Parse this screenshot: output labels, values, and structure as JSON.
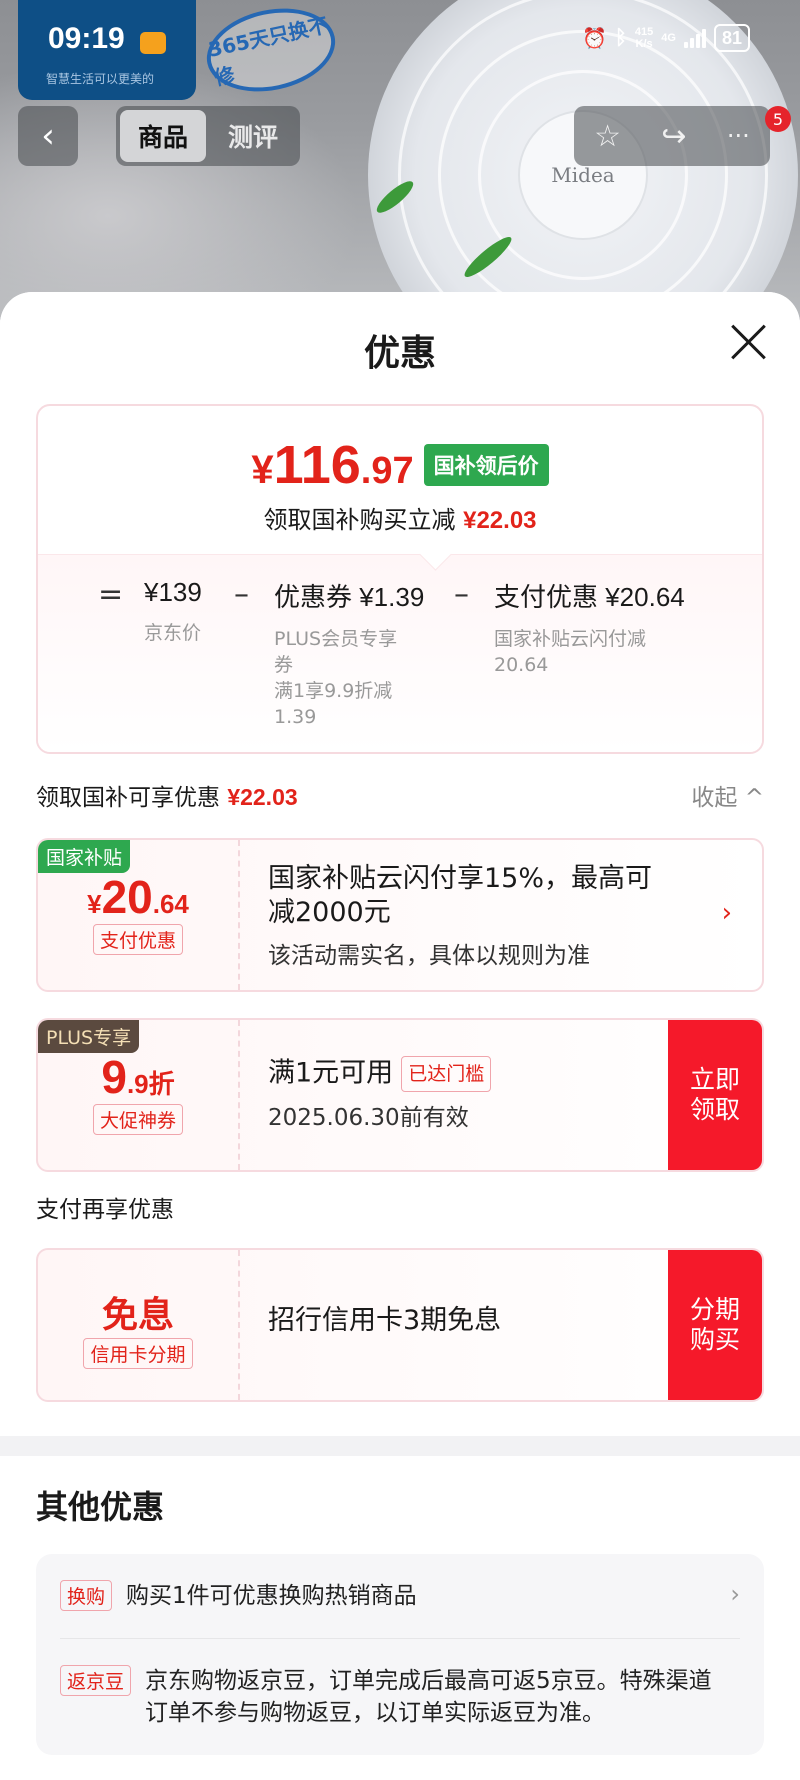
{
  "status_bar": {
    "time": "09:19",
    "slogan": "智慧生活可以更美的",
    "promo_stamp": "365天只换不修",
    "network_speed_top": "415",
    "network_speed_bottom": "K/s",
    "network_type": "4G",
    "battery": "81"
  },
  "nav": {
    "back_icon": "‹",
    "tabs": [
      "商品",
      "测评"
    ],
    "active_tab": "商品",
    "cart_badge": "5"
  },
  "hero": {
    "brand_on_product": "Midea"
  },
  "sheet": {
    "title": "优惠"
  },
  "summary": {
    "currency": "¥",
    "final_price_int": "116",
    "final_price_dec": ".97",
    "final_price_tag": "国补领后价",
    "reduce_text": "领取国补购买立减",
    "reduce_amount": "¥22.03",
    "breakdown": {
      "equals": "=",
      "minus": "–",
      "jd_price": "¥139",
      "jd_price_label": "京东价",
      "coupon_title": "优惠券 ¥1.39",
      "coupon_desc_1": "PLUS会员专享",
      "coupon_desc_2": "券",
      "coupon_desc_3": "满1享9.9折减",
      "coupon_desc_4": "1.39",
      "pay_title": "支付优惠 ¥20.64",
      "pay_desc_1": "国家补贴云闪付减",
      "pay_desc_2": "20.64"
    }
  },
  "available": {
    "label": "领取国补可享优惠",
    "amount": "¥22.03",
    "collapse": "收起",
    "collapse_icon": "^"
  },
  "coupons": [
    {
      "badge": "国家补贴",
      "amount_currency": "¥",
      "amount_int": "20",
      "amount_dec": ".64",
      "tag": "支付优惠",
      "title": "国家补贴云闪付享15%，最高可减2000元",
      "subtitle": "该活动需实名，具体以规则为准",
      "chevron": "›"
    },
    {
      "badge": "PLUS专享",
      "amount_int": "9",
      "amount_dec": ".9折",
      "tag": "大促神券",
      "title": "满1元可用",
      "status": "已达门槛",
      "subtitle": "2025.06.30前有效",
      "action": "立即领取"
    }
  ],
  "payment": {
    "section_label": "支付再享优惠",
    "title_big": "免息",
    "tag": "信用卡分期",
    "desc": "招行信用卡3期免息",
    "action": "分期购买"
  },
  "other": {
    "title": "其他优惠",
    "items": [
      {
        "tag": "换购",
        "text": "购买1件可优惠换购热销商品",
        "chevron": "›"
      },
      {
        "tag": "返京豆",
        "text": "京东购物返京豆，订单完成后最高可返5京豆。特殊渠道订单不参与购物返豆，以订单实际返豆为准。"
      }
    ]
  },
  "colors": {
    "accent_red": "#e2231a",
    "action_red": "#f5192a",
    "green_tag": "#2ea84f",
    "status_blue": "#0e4f86"
  }
}
